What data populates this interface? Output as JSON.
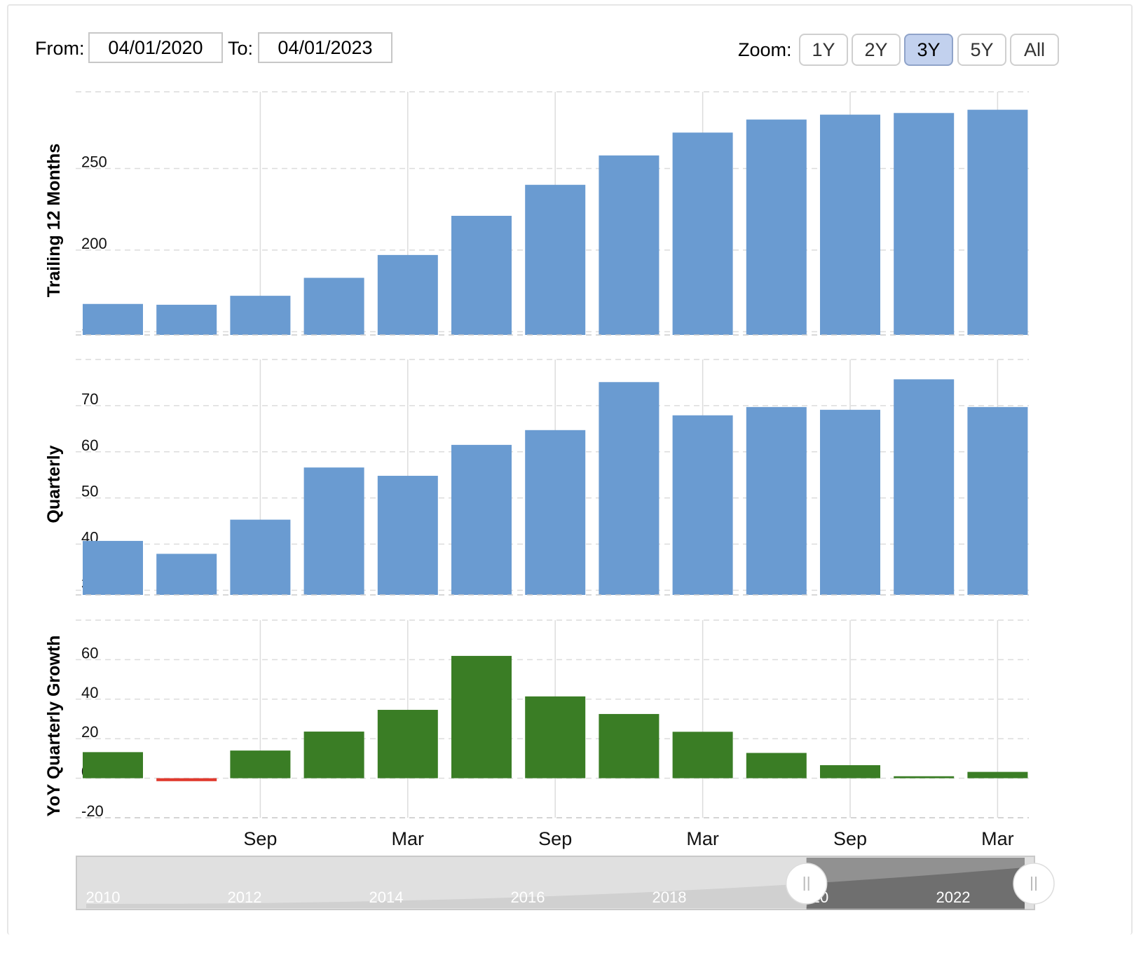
{
  "range": {
    "from_label": "From:",
    "from_value": "04/01/2020",
    "to_label": "To:",
    "to_value": "04/01/2023"
  },
  "zoom": {
    "label": "Zoom:",
    "buttons": [
      "1Y",
      "2Y",
      "3Y",
      "5Y",
      "All"
    ],
    "active": "3Y"
  },
  "colors": {
    "bar_blue": "#6a9bd1",
    "bar_green": "#3a7d25",
    "bar_negative": "#e03a2e",
    "grid": "#dcdcdc",
    "navigator_bg": "#e0e0e0",
    "navigator_selected": "#8c8c8c"
  },
  "chart_data": [
    {
      "type": "bar",
      "ylabel": "Trailing 12 Months",
      "yticks": [
        150,
        200,
        250
      ],
      "ylim": [
        148,
        297
      ],
      "values": [
        167,
        166.5,
        172,
        183,
        197,
        221,
        240,
        258,
        272,
        280,
        283,
        284,
        286
      ]
    },
    {
      "type": "bar",
      "ylabel": "Quarterly",
      "yticks": [
        30,
        40,
        50,
        60,
        70
      ],
      "ylim": [
        29,
        80
      ],
      "values": [
        40.7,
        37.9,
        45.3,
        56.6,
        54.8,
        61.5,
        64.7,
        75.1,
        67.9,
        69.7,
        69.1,
        75.7,
        69.7
      ]
    },
    {
      "type": "bar",
      "ylabel": "YoY Quarterly Growth",
      "yticks": [
        -20,
        0,
        20,
        40,
        60
      ],
      "ylim": [
        -20,
        80
      ],
      "values": [
        13.2,
        -1.5,
        14,
        23.6,
        34.6,
        61.9,
        41.4,
        32.5,
        23.5,
        12.8,
        6.6,
        1,
        3.2
      ]
    }
  ],
  "x_axis": {
    "tick_labels": [
      "Sep",
      "Mar",
      "Sep",
      "Mar",
      "Sep",
      "Mar"
    ],
    "tick_bar_index": [
      2.5,
      4.5,
      6.5,
      8.5,
      10.5,
      12.5
    ]
  },
  "navigator": {
    "year_labels": [
      "2010",
      "2012",
      "2014",
      "2016",
      "2018",
      "20",
      "2022"
    ],
    "selected_start_fraction": 0.762,
    "selected_end_fraction": 1.0
  }
}
